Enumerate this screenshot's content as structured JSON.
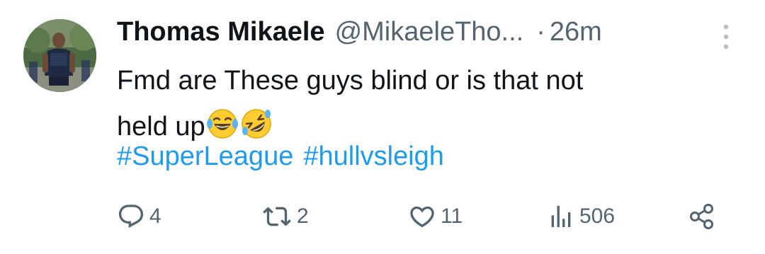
{
  "tweet": {
    "display_name": "Thomas Mikaele",
    "handle": "@MikaeleTho...",
    "separator": "·",
    "time": "26m",
    "text_line1": "Fmd are These guys blind or is that not",
    "text_line2": "held up",
    "emojis": [
      "face-with-tears-of-joy",
      "rolling-on-the-floor-laughing"
    ],
    "hashtags": [
      "#SuperLeague",
      "#hullvsleigh"
    ]
  },
  "actions": {
    "replies": "4",
    "retweets": "2",
    "likes": "11",
    "views": "506"
  },
  "colors": {
    "text": "#0f1419",
    "secondary": "#536471",
    "link": "#1d9bf0"
  },
  "icons": [
    "reply-icon",
    "retweet-icon",
    "like-icon",
    "views-icon",
    "share-icon",
    "more-icon"
  ]
}
